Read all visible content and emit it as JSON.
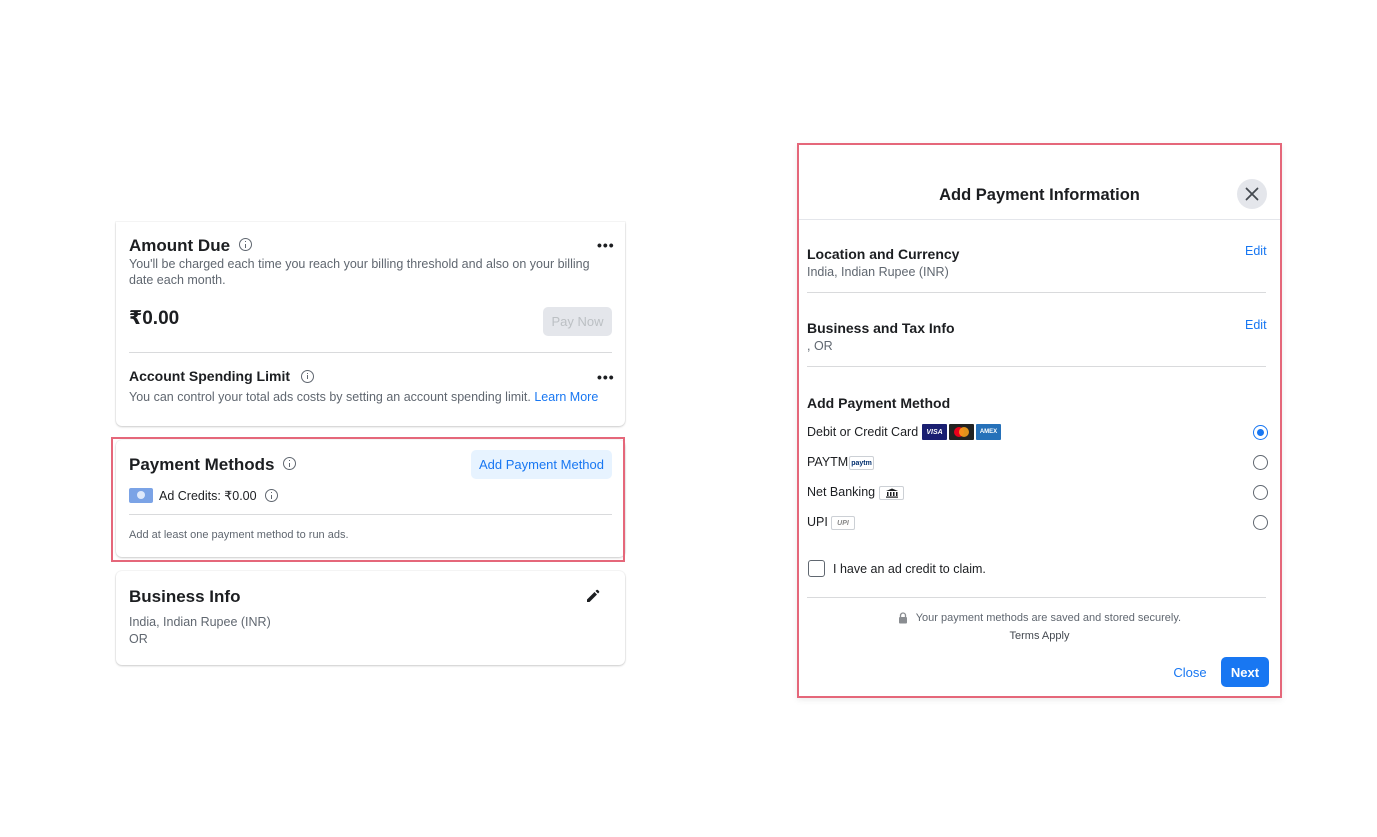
{
  "amount_due": {
    "title": "Amount Due",
    "description": "You'll be charged each time you reach your billing threshold and also on your billing date each month.",
    "amount": "₹0.00",
    "pay_now": "Pay Now",
    "menu_glyph": "•••",
    "spending_limit_title": "Account Spending Limit",
    "spending_limit_desc": "You can control your total ads costs by setting an account spending limit.",
    "learn_more": "Learn More"
  },
  "payment_methods": {
    "title": "Payment Methods",
    "add_button": "Add Payment Method",
    "ad_credits": "Ad Credits: ₹0.00",
    "note": "Add at least one payment method to run ads."
  },
  "business_info": {
    "title": "Business Info",
    "location": "India, Indian Rupee (INR)",
    "state": "OR"
  },
  "modal": {
    "title": "Add Payment Information",
    "location_title": "Location and Currency",
    "location_value": "India, Indian Rupee (INR)",
    "business_title": "Business and Tax Info",
    "business_value": ", OR",
    "edit_label": "Edit",
    "add_method_title": "Add Payment Method",
    "options": [
      {
        "label": "Debit or Credit Card",
        "selected": true
      },
      {
        "label": "PAYTM",
        "selected": false
      },
      {
        "label": "Net Banking",
        "selected": false
      },
      {
        "label": "UPI",
        "selected": false
      }
    ],
    "card_logos": [
      "VISA",
      "mastercard",
      "AMEX"
    ],
    "paytm_logo": "paytm",
    "upi_logo": "UPI",
    "ad_credit_checkbox": "I have an ad credit to claim.",
    "secure_note": "Your payment methods are saved and stored securely.",
    "terms": "Terms Apply",
    "close_button": "Close",
    "next_button": "Next"
  },
  "colors": {
    "accent": "#1877f2",
    "highlight": "#e5677a",
    "visa": "#1a1f71",
    "mastercard": "#222222",
    "amex": "#2671b9"
  }
}
